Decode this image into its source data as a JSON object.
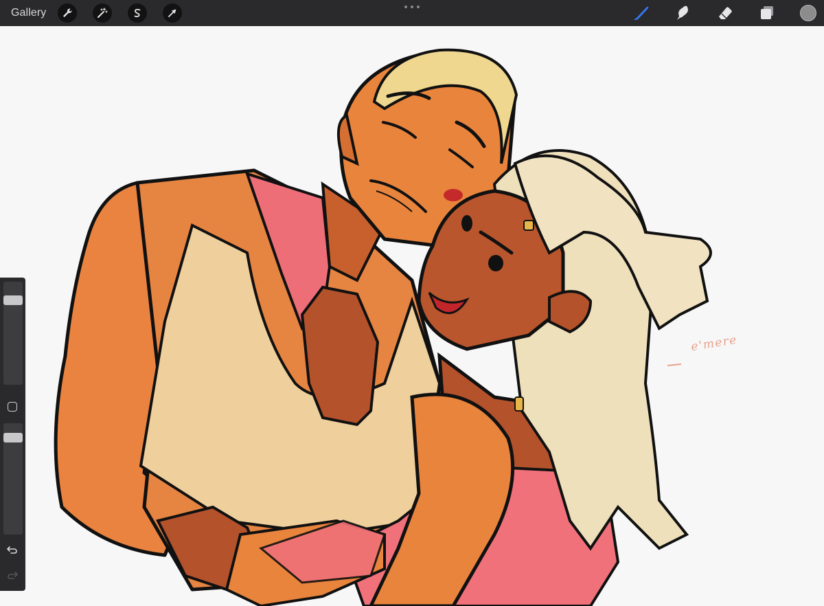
{
  "app": {
    "gallery_label": "Gallery",
    "accent_color": "#3478f6",
    "current_color": "#8c8c8c"
  },
  "toolbar_left": [
    {
      "name": "actions-wrench-icon"
    },
    {
      "name": "adjustments-wand-icon"
    },
    {
      "name": "selection-s-icon"
    },
    {
      "name": "transform-arrow-icon"
    }
  ],
  "toolbar_right": [
    {
      "name": "brush-icon",
      "active": true
    },
    {
      "name": "smudge-icon",
      "active": false
    },
    {
      "name": "eraser-icon",
      "active": false
    },
    {
      "name": "layers-icon",
      "active": false
    }
  ],
  "sidebar": {
    "brush_size_level": 0.13,
    "opacity_level": 0.92
  },
  "artwork": {
    "signature": "e'mere"
  }
}
